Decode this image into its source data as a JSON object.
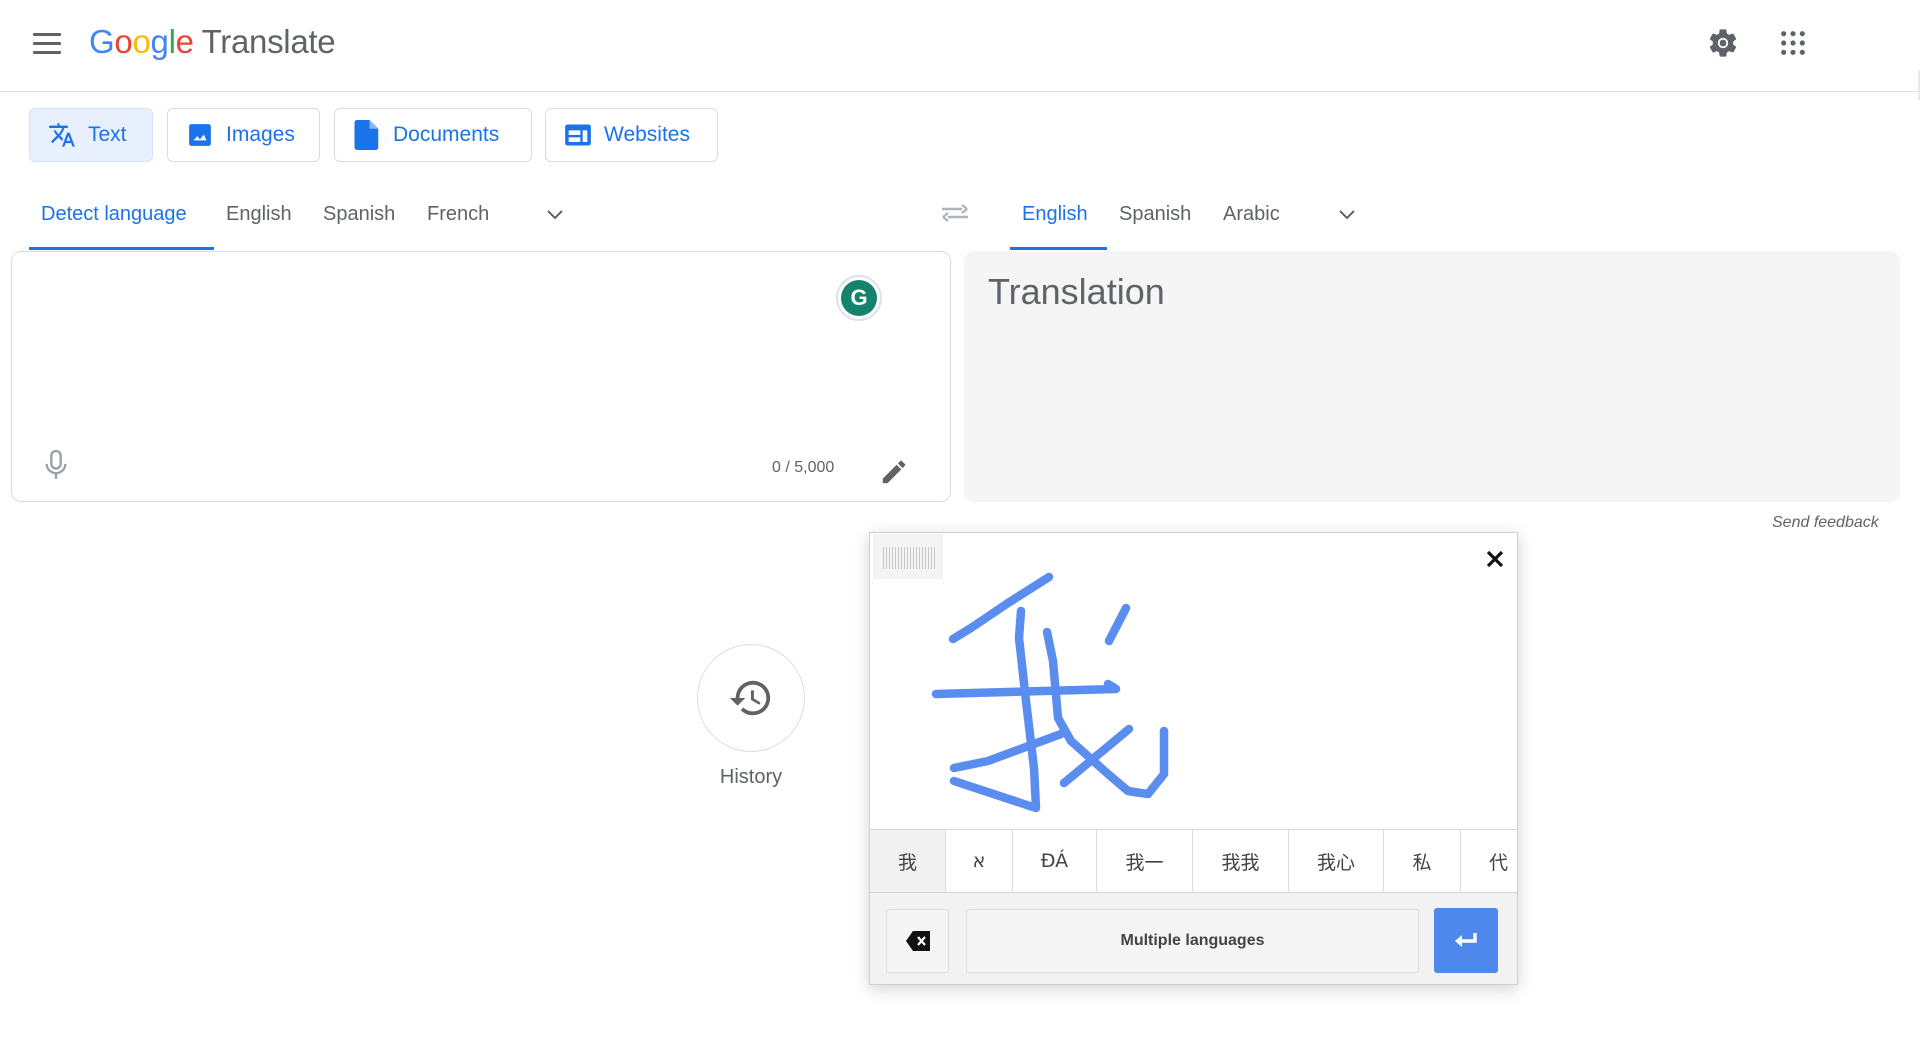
{
  "header": {
    "logo_google": [
      "G",
      "o",
      "o",
      "g",
      "l",
      "e"
    ],
    "logo_product": "Translate",
    "menu_icon": "hamburger-menu-icon",
    "settings_icon": "gear-icon",
    "apps_icon": "apps-grid-icon"
  },
  "modes": [
    {
      "label": "Text",
      "icon": "translate-icon",
      "active": true
    },
    {
      "label": "Images",
      "icon": "image-icon",
      "active": false
    },
    {
      "label": "Documents",
      "icon": "document-icon",
      "active": false
    },
    {
      "label": "Websites",
      "icon": "website-icon",
      "active": false
    }
  ],
  "source_langs": {
    "tabs": [
      "Detect language",
      "English",
      "Spanish",
      "French"
    ],
    "active": "Detect language"
  },
  "target_langs": {
    "tabs": [
      "English",
      "Spanish",
      "Arabic"
    ],
    "active": "English"
  },
  "source": {
    "value": "",
    "char_count": "0 / 5,000",
    "grammarly_letter": "G"
  },
  "target": {
    "placeholder": "Translation"
  },
  "send_feedback": "Send feedback",
  "history": {
    "label": "History"
  },
  "handwriting": {
    "candidates": [
      "我",
      "א",
      "ĐÁ",
      "我一",
      "我我",
      "我心",
      "私",
      "代"
    ],
    "language_button": "Multiple languages",
    "ink_color": "#5b8def",
    "enter_color": "#4e88ec"
  },
  "colors": {
    "accent": "#1a73e8",
    "text_secondary": "#5f6368",
    "active_mode_bg": "#e8f0fe",
    "target_bg": "#f5f5f5"
  }
}
